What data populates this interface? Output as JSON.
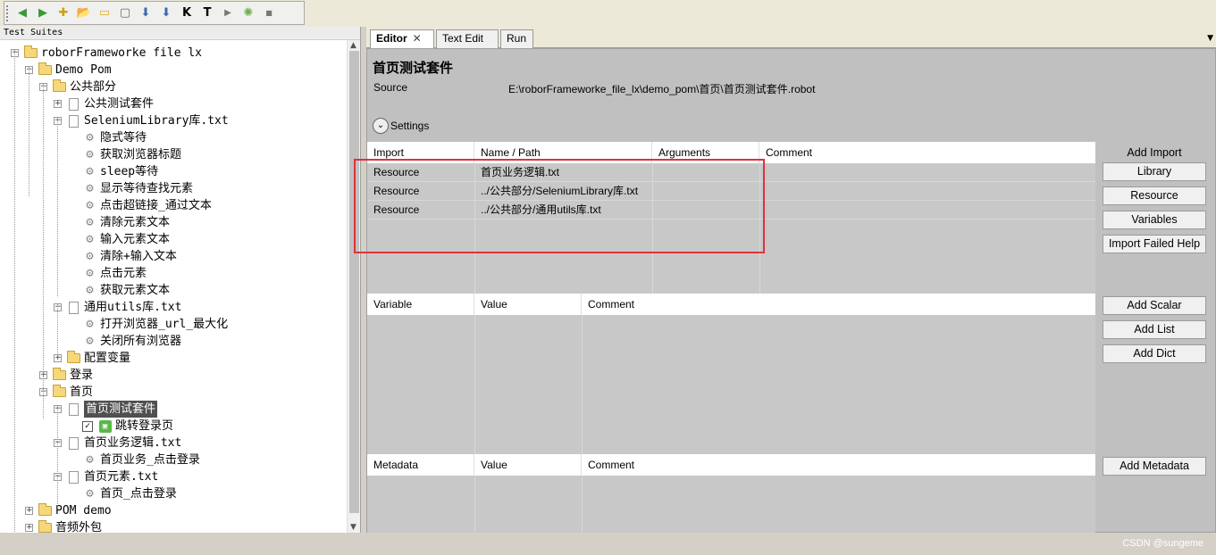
{
  "toolbar": {
    "icons": [
      "back-icon",
      "forward-icon",
      "new-file-icon",
      "open-folder-icon",
      "new-folder-icon",
      "page-icon",
      "save-icon",
      "save-all-icon",
      "keyword-search-icon",
      "text-search-icon",
      "run-icon",
      "debug-icon",
      "stop-icon"
    ],
    "glyphs": [
      "◀",
      "▶",
      "✚",
      "📂",
      "▭",
      "▢",
      "⬇",
      "⬇",
      "K",
      "T",
      "▶",
      "✺",
      "■"
    ]
  },
  "tree": {
    "header": "Test Suites",
    "nodes": [
      {
        "label": "roborFrameworke file lx"
      },
      {
        "label": "Demo Pom"
      },
      {
        "label": "公共部分"
      },
      {
        "label": "公共测试套件"
      },
      {
        "label": "SeleniumLibrary库.txt"
      },
      {
        "label": "隐式等待"
      },
      {
        "label": "获取浏览器标题"
      },
      {
        "label": "sleep等待"
      },
      {
        "label": "显示等待查找元素"
      },
      {
        "label": "点击超链接_通过文本"
      },
      {
        "label": "清除元素文本"
      },
      {
        "label": "输入元素文本"
      },
      {
        "label": "清除+输入文本"
      },
      {
        "label": "点击元素"
      },
      {
        "label": "获取元素文本"
      },
      {
        "label": "通用utils库.txt"
      },
      {
        "label": "打开浏览器_url_最大化"
      },
      {
        "label": "关闭所有浏览器"
      },
      {
        "label": "配置变量"
      },
      {
        "label": "登录"
      },
      {
        "label": "首页"
      },
      {
        "label": "首页测试套件"
      },
      {
        "label": "跳转登录页"
      },
      {
        "label": "首页业务逻辑.txt"
      },
      {
        "label": "首页业务_点击登录"
      },
      {
        "label": "首页元素.txt"
      },
      {
        "label": "首页_点击登录"
      },
      {
        "label": "POM demo"
      },
      {
        "label": "音频外包"
      }
    ]
  },
  "tabs": [
    {
      "label": "Editor",
      "close": "✕"
    },
    {
      "label": "Text Edit"
    },
    {
      "label": "Run"
    }
  ],
  "editor": {
    "title": "首页测试套件",
    "source_label": "Source",
    "source_path": "E:\\roborFrameworke_file_lx\\demo_pom\\首页\\首页测试套件.robot",
    "settings_label": "Settings",
    "imports": {
      "headers": [
        "Import",
        "Name / Path",
        "Arguments",
        "Comment"
      ],
      "rows": [
        [
          "Resource",
          "首页业务逻辑.txt",
          "",
          ""
        ],
        [
          "Resource",
          "../公共部分/SeleniumLibrary库.txt",
          "",
          ""
        ],
        [
          "Resource",
          "../公共部分/通用utils库.txt",
          "",
          ""
        ]
      ],
      "side_label": "Add Import",
      "buttons": [
        "Library",
        "Resource",
        "Variables",
        "Import Failed Help"
      ]
    },
    "variables": {
      "headers": [
        "Variable",
        "Value",
        "Comment"
      ],
      "buttons": [
        "Add Scalar",
        "Add List",
        "Add Dict"
      ]
    },
    "metadata": {
      "headers": [
        "Metadata",
        "Value",
        "Comment"
      ],
      "buttons": [
        "Add Metadata"
      ]
    }
  },
  "watermark": "CSDN @sungeme",
  "colors": {
    "highlight": "#e0323a",
    "selected": "#505050",
    "robot_icon": "#58b947"
  }
}
